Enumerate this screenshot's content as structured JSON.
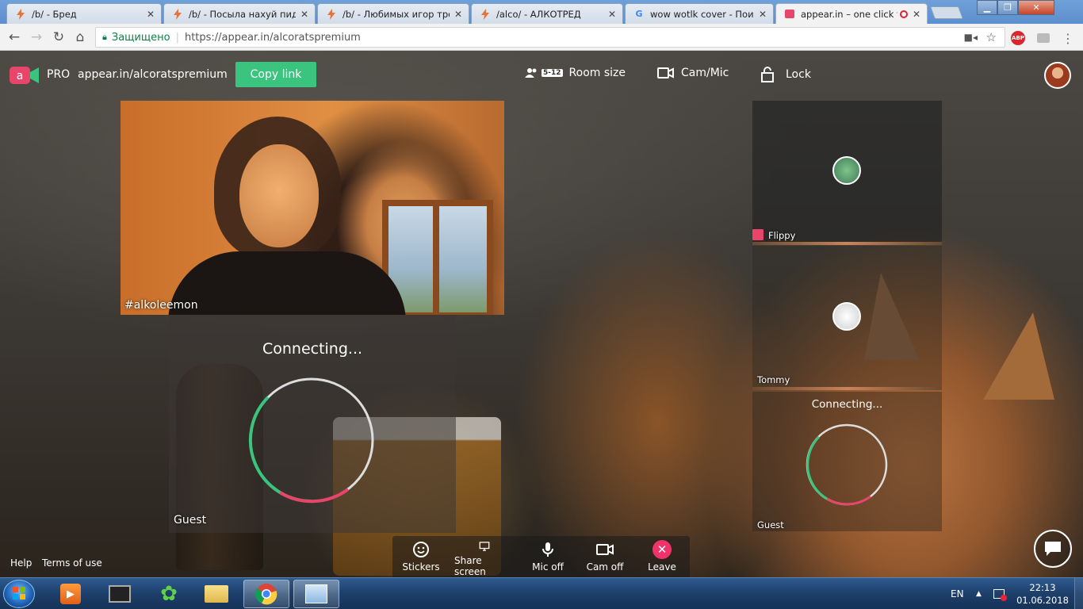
{
  "browser": {
    "tabs": [
      {
        "title": "/b/ - Бред",
        "favicon": "lightning-icon"
      },
      {
        "title": "/b/ - Посыла нахуй пида",
        "favicon": "lightning-icon"
      },
      {
        "title": "/b/ - Любимых игор тре",
        "favicon": "lightning-icon"
      },
      {
        "title": "/alco/ - АЛКОТРЕД",
        "favicon": "lightning-icon"
      },
      {
        "title": "wow wotlk cover - Поиск",
        "favicon": "google-icon"
      },
      {
        "title": "appear.in – one click v",
        "favicon": "appear-icon"
      }
    ],
    "security_label": "Защищено",
    "url": "https://appear.in/alcoratspremium"
  },
  "app": {
    "plan": "PRO",
    "room_url": "appear.in/alcoratspremium",
    "copy_link": "Copy link",
    "room_size_badge": "5-12",
    "room_size": "Room size",
    "cam_mic": "Cam/Mic",
    "lock": "Lock"
  },
  "participants": {
    "main": "#alkoleemon",
    "guest_big": {
      "status": "Connecting...",
      "name": "Guest"
    },
    "flippy": "Flippy",
    "tommy": "Tommy",
    "guest_small": {
      "status": "Connecting...",
      "name": "Guest"
    }
  },
  "controls": {
    "stickers": "Stickers",
    "share_screen": "Share screen",
    "mic_off": "Mic off",
    "cam_off": "Cam off",
    "leave": "Leave"
  },
  "footer": {
    "help": "Help",
    "terms": "Terms of use"
  },
  "taskbar": {
    "lang": "EN",
    "time": "22:13",
    "date": "01.06.2018"
  },
  "colors": {
    "accent_green": "#3ac47e",
    "leave_red": "#f0346b",
    "ring_green": "#3ac47e",
    "ring_red": "#e8456b"
  }
}
